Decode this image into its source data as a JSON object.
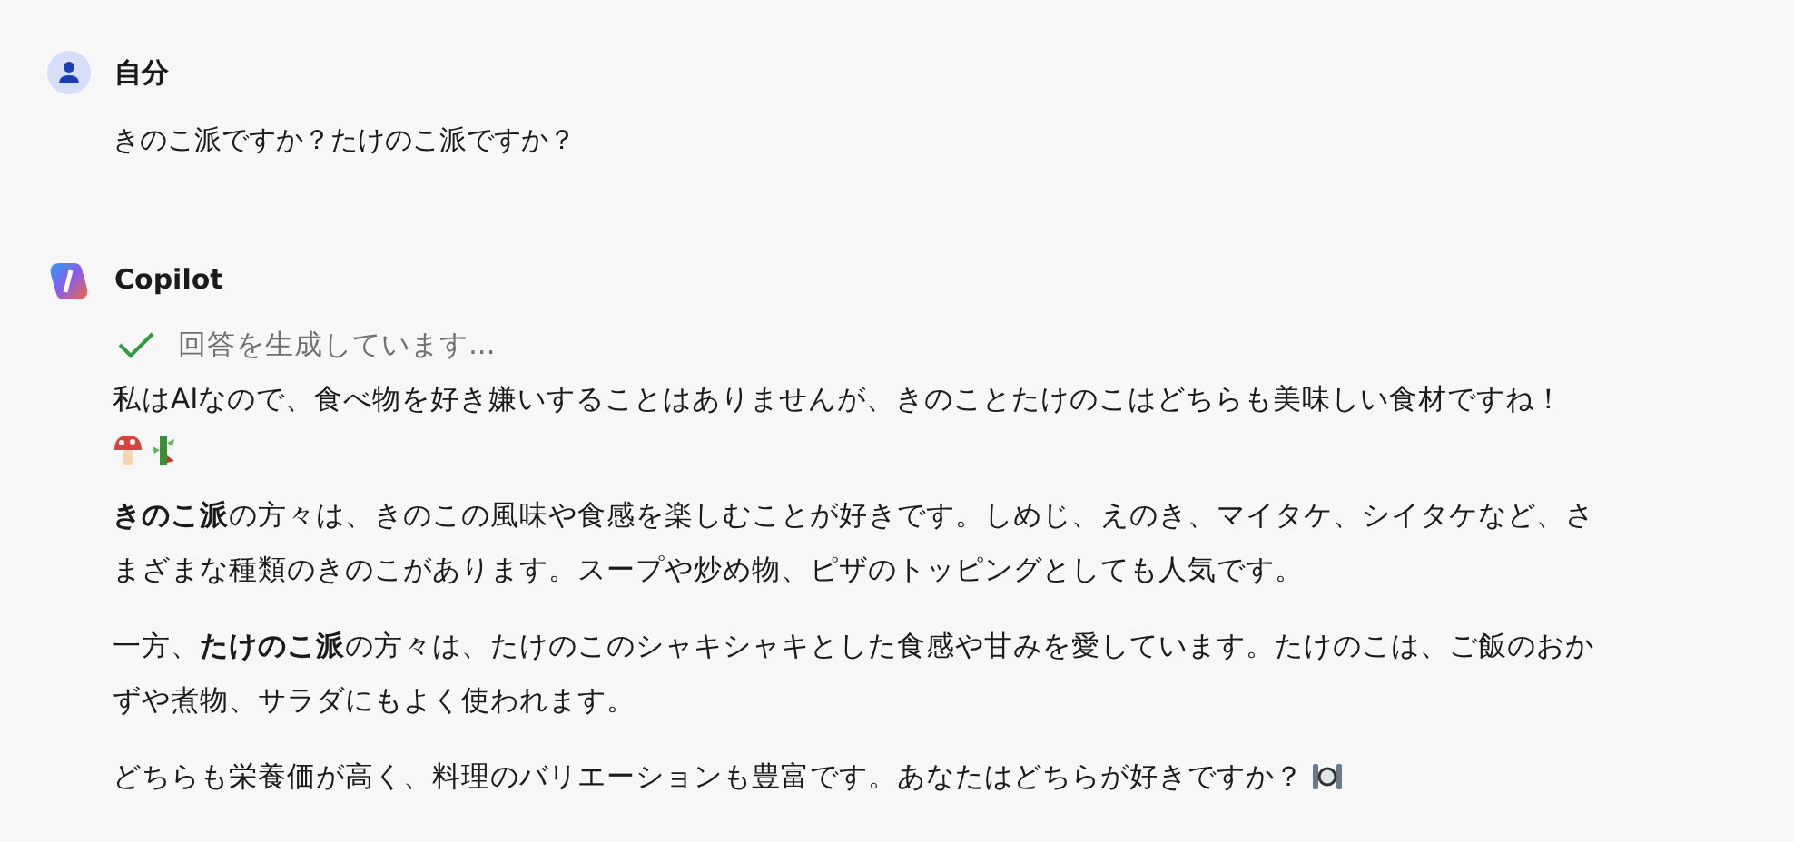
{
  "messages": [
    {
      "kind": "user",
      "author": "自分",
      "text": "きのこ派ですか？たけのこ派ですか？"
    },
    {
      "kind": "bot",
      "author": "Copilot",
      "status": {
        "text": "回答を生成しています...",
        "done": true
      },
      "paragraphs": [
        {
          "text": "私はAIなので、食べ物を好き嫌いすることはありませんが、きのことたけのこはどちらも美味しい食材ですね！",
          "trailing": [
            {
              "kind": "mushroom"
            },
            {
              "kind": "bamboo"
            }
          ]
        },
        {
          "text": "**きのこ派**の方々は、きのこの風味や食感を楽しむことが好きです。しめじ、えのき、マイタケ、シイタケなど、さまざまな種類のきのこがあります。スープや炒め物、ピザのトッピングとしても人気です。"
        },
        {
          "text": "一方、**たけのこ派**の方々は、たけのこのシャキシャキとした食感や甘みを愛しています。たけのこは、ご飯のおかずや煮物、サラダにもよく使われます。"
        },
        {
          "text": "どちらも栄養価が高く、料理のバリエーションも豊富です。あなたはどちらが好きですか？",
          "trailing": [
            {
              "kind": "plate"
            }
          ]
        }
      ]
    }
  ]
}
